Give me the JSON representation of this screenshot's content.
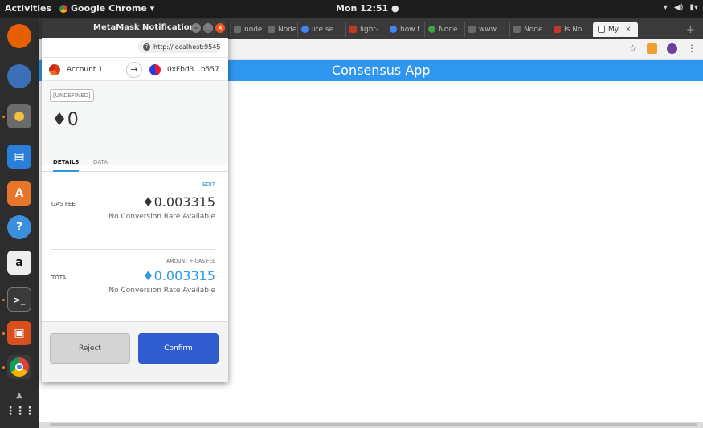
{
  "topbar": {
    "activities": "Activities",
    "app_name": "Google Chrome ▾",
    "clock": "Mon 12:51 ●",
    "status_icons": [
      "wifi-icon",
      "volume-icon",
      "battery-icon"
    ]
  },
  "dock": {
    "items": [
      {
        "name": "firefox-icon",
        "color": "#e66000"
      },
      {
        "name": "thunderbird-icon",
        "color": "#3b6fb6"
      },
      {
        "name": "files-icon",
        "color": "#6b6b6b"
      },
      {
        "name": "writer-icon",
        "color": "#2a7fd8"
      },
      {
        "name": "software-center-icon",
        "color": "#e8762a"
      },
      {
        "name": "help-icon",
        "color": "#3e8ede"
      },
      {
        "name": "amazon-icon",
        "color": "#eeeeee"
      },
      {
        "name": "terminal-icon",
        "color": "#3a3a3a"
      },
      {
        "name": "impress-icon",
        "color": "#d9501e"
      },
      {
        "name": "chrome-icon",
        "color": "#4285f4"
      },
      {
        "name": "show-apps-icon",
        "color": "#2d2d2d"
      }
    ]
  },
  "chrome": {
    "tabs": [
      "node",
      "Node",
      "lite se",
      "light-",
      "how t",
      "Node",
      "www.",
      "Node",
      "Is No"
    ],
    "active_tab": "My",
    "app_header": "Consensus App"
  },
  "metamask": {
    "window_title": "MetaMask Notification",
    "origin": "http://localhost:9545",
    "from_account": "Account 1",
    "to_address": "0xFbd3...b557",
    "method_badge": "[UNDEFINED]",
    "amount": "♦0",
    "tabs": {
      "details": "DETAILS",
      "data": "DATA"
    },
    "edit_label": "EDIT",
    "gas_fee_label": "GAS FEE",
    "gas_fee_value": "♦0.003315",
    "gas_fee_conversion": "No Conversion Rate Available",
    "total_header": "AMOUNT + GAS FEE",
    "total_label": "TOTAL",
    "total_value": "♦0.003315",
    "total_conversion": "No Conversion Rate Available",
    "reject_label": "Reject",
    "confirm_label": "Confirm"
  },
  "colors": {
    "header_blue": "#2f96ef",
    "confirm_blue": "#2f5cce",
    "link_blue": "#2f9ae0"
  }
}
